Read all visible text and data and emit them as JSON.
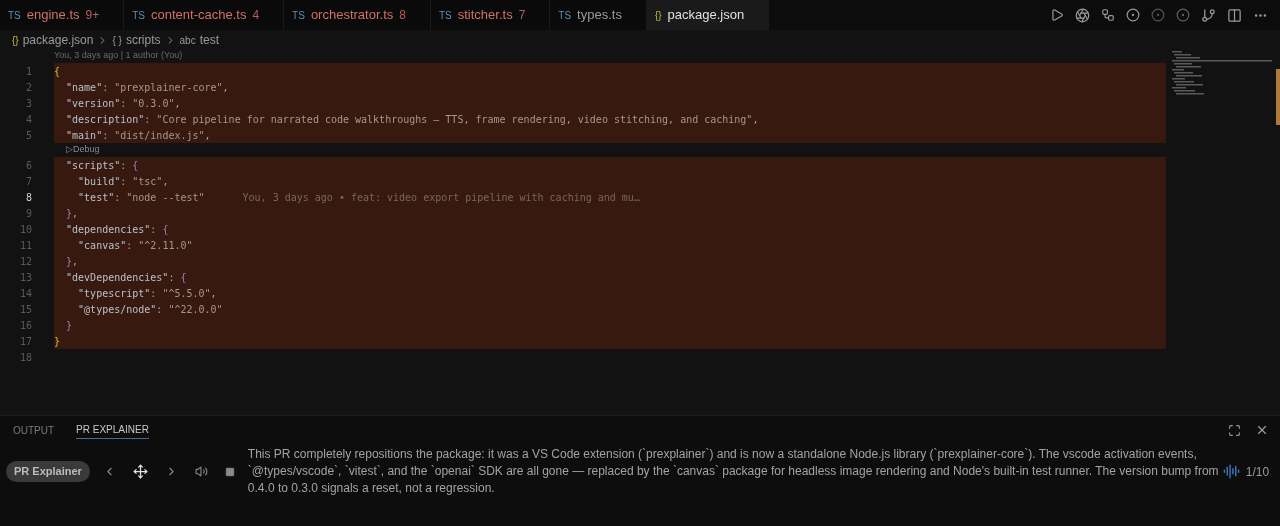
{
  "tabs": [
    {
      "icon": "TS",
      "label": "engine.ts",
      "badge": "9+",
      "has_problems": true,
      "selected": false
    },
    {
      "icon": "TS",
      "label": "content-cache.ts",
      "badge": "4",
      "has_problems": true,
      "selected": false
    },
    {
      "icon": "TS",
      "label": "orchestrator.ts",
      "badge": "8",
      "has_problems": true,
      "selected": false
    },
    {
      "icon": "TS",
      "label": "stitcher.ts",
      "badge": "7",
      "has_problems": true,
      "selected": false
    },
    {
      "icon": "TS",
      "label": "types.ts",
      "has_problems": false,
      "selected": false
    },
    {
      "icon": "{}",
      "label": "package.json",
      "has_problems": false,
      "selected": true
    }
  ],
  "breadcrumbs": [
    {
      "icon": "{}",
      "label": "package.json"
    },
    {
      "icon": "{ }",
      "label": "scripts"
    },
    {
      "icon": "abc",
      "label": "test"
    }
  ],
  "blame_header": "You, 3 days ago | 1 author (You)",
  "lines": [
    {
      "number": "1",
      "highlighted": true,
      "current": false,
      "tokens": [
        {
          "kind": "brace",
          "text": "{"
        }
      ]
    },
    {
      "number": "2",
      "highlighted": true,
      "current": false,
      "tokens": [
        {
          "kind": "key",
          "text": "  \"name\""
        },
        {
          "kind": "punct",
          "text": ": "
        },
        {
          "kind": "string",
          "text": "\"prexplainer-core\""
        },
        {
          "kind": "punct",
          "text": ","
        }
      ]
    },
    {
      "number": "3",
      "highlighted": true,
      "current": false,
      "tokens": [
        {
          "kind": "key",
          "text": "  \"version\""
        },
        {
          "kind": "punct",
          "text": ": "
        },
        {
          "kind": "string",
          "text": "\"0.3.0\""
        },
        {
          "kind": "punct",
          "text": ","
        }
      ]
    },
    {
      "number": "4",
      "highlighted": true,
      "current": false,
      "tokens": [
        {
          "kind": "key",
          "text": "  \"description\""
        },
        {
          "kind": "punct",
          "text": ": "
        },
        {
          "kind": "string",
          "text": "\"Core pipeline for narrated code walkthroughs — TTS, frame rendering, video stitching, and caching\""
        },
        {
          "kind": "punct",
          "text": ","
        }
      ]
    },
    {
      "number": "5",
      "highlighted": true,
      "current": false,
      "tokens": [
        {
          "kind": "key",
          "text": "  \"main\""
        },
        {
          "kind": "punct",
          "text": ": "
        },
        {
          "kind": "string",
          "text": "\"dist/index.js\""
        },
        {
          "kind": "punct",
          "text": ","
        }
      ]
    },
    {
      "kind": "lens",
      "text": "▷Debug"
    },
    {
      "number": "6",
      "highlighted": true,
      "current": false,
      "tokens": [
        {
          "kind": "key",
          "text": "  \"scripts\""
        },
        {
          "kind": "punct",
          "text": ": "
        },
        {
          "kind": "brace2",
          "text": "{"
        }
      ]
    },
    {
      "number": "7",
      "highlighted": true,
      "current": false,
      "tokens": [
        {
          "kind": "key",
          "text": "    \"build\""
        },
        {
          "kind": "punct",
          "text": ": "
        },
        {
          "kind": "string",
          "text": "\"tsc\""
        },
        {
          "kind": "punct",
          "text": ","
        }
      ]
    },
    {
      "number": "8",
      "highlighted": true,
      "current": true,
      "blame": "You, 3 days ago • feat: video export pipeline with caching and mu…",
      "tokens": [
        {
          "kind": "key",
          "text": "    \"test\""
        },
        {
          "kind": "punct",
          "text": ": "
        },
        {
          "kind": "string",
          "text": "\"node --test\""
        }
      ]
    },
    {
      "number": "9",
      "highlighted": true,
      "current": false,
      "tokens": [
        {
          "kind": "brace2",
          "text": "  }"
        },
        {
          "kind": "punct",
          "text": ","
        }
      ]
    },
    {
      "number": "10",
      "highlighted": true,
      "current": false,
      "tokens": [
        {
          "kind": "key",
          "text": "  \"dependencies\""
        },
        {
          "kind": "punct",
          "text": ": "
        },
        {
          "kind": "brace2",
          "text": "{"
        }
      ]
    },
    {
      "number": "11",
      "highlighted": true,
      "current": false,
      "tokens": [
        {
          "kind": "key",
          "text": "    \"canvas\""
        },
        {
          "kind": "punct",
          "text": ": "
        },
        {
          "kind": "string",
          "text": "\"^2.11.0\""
        }
      ]
    },
    {
      "number": "12",
      "highlighted": true,
      "current": false,
      "tokens": [
        {
          "kind": "brace2",
          "text": "  }"
        },
        {
          "kind": "punct",
          "text": ","
        }
      ]
    },
    {
      "number": "13",
      "highlighted": true,
      "current": false,
      "tokens": [
        {
          "kind": "key",
          "text": "  \"devDependencies\""
        },
        {
          "kind": "punct",
          "text": ": "
        },
        {
          "kind": "brace2",
          "text": "{"
        }
      ]
    },
    {
      "number": "14",
      "highlighted": true,
      "current": false,
      "tokens": [
        {
          "kind": "key",
          "text": "    \"typescript\""
        },
        {
          "kind": "punct",
          "text": ": "
        },
        {
          "kind": "string",
          "text": "\"^5.5.0\""
        },
        {
          "kind": "punct",
          "text": ","
        }
      ]
    },
    {
      "number": "15",
      "highlighted": true,
      "current": false,
      "tokens": [
        {
          "kind": "key",
          "text": "    \"@types/node\""
        },
        {
          "kind": "punct",
          "text": ": "
        },
        {
          "kind": "string",
          "text": "\"^22.0.0\""
        }
      ]
    },
    {
      "number": "16",
      "highlighted": true,
      "current": false,
      "tokens": [
        {
          "kind": "brace2",
          "text": "  }"
        }
      ]
    },
    {
      "number": "17",
      "highlighted": true,
      "current": false,
      "tokens": [
        {
          "kind": "brace",
          "text": "}"
        }
      ]
    },
    {
      "number": "18",
      "highlighted": false,
      "current": false
    }
  ],
  "panel": {
    "tabs": [
      {
        "label": "OUTPUT",
        "selected": false
      },
      {
        "label": "PR EXPLAINER",
        "selected": true
      }
    ],
    "badge": "PR Explainer",
    "explanation": "This PR completely repositions the package: it was a VS Code extension (`prexplainer`) and is now a standalone Node.js library (`prexplainer-core`). The vscode activation events, `@types/vscode`, `vitest`, and the `openai` SDK are all gone — replaced by the `canvas` package for headless image rendering and Node's built-in test runner. The version bump from 0.4.0 to 0.3.0 signals a reset, not a regression.",
    "counter": "1/10"
  }
}
